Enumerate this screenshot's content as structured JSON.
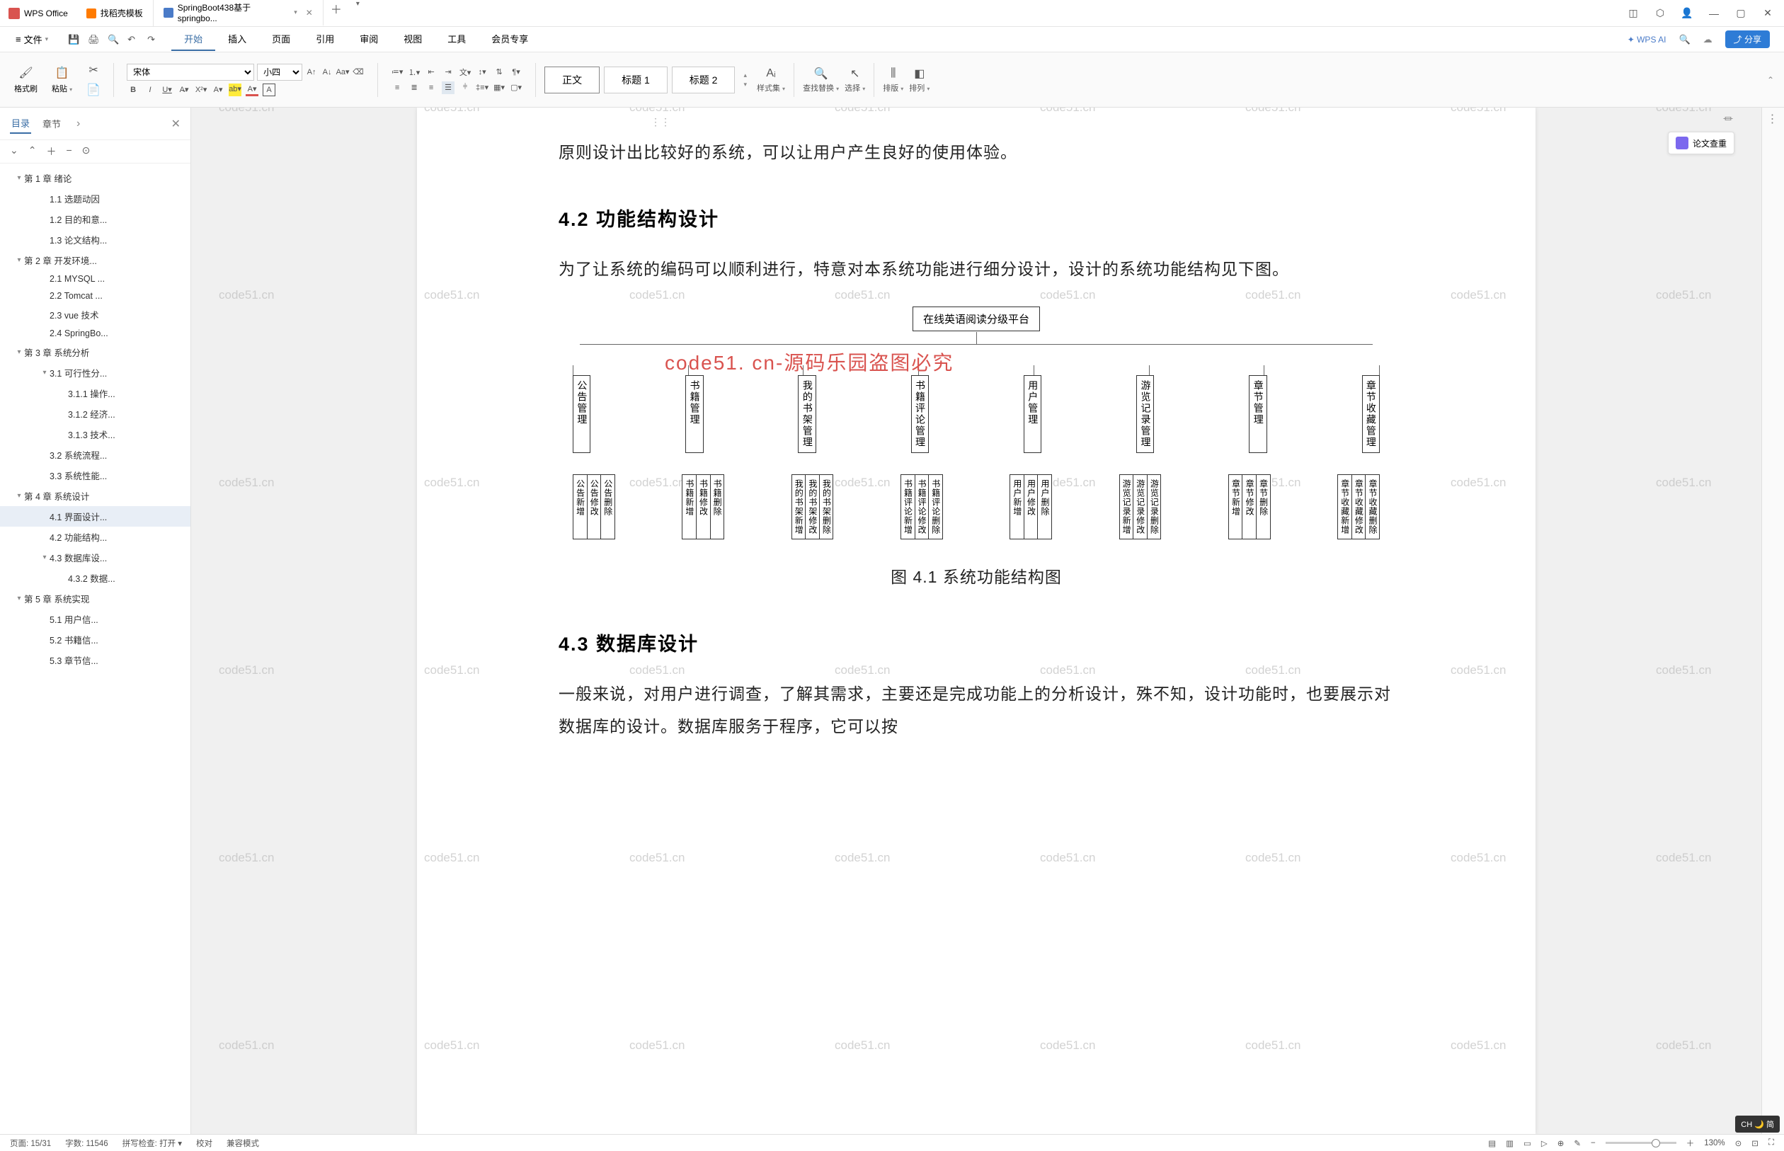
{
  "titlebar": {
    "app_name": "WPS Office",
    "tabs": [
      {
        "label": "找稻壳模板",
        "icon": "orange"
      },
      {
        "label": "SpringBoot438基于springbo...",
        "icon": "blue",
        "active": true
      }
    ]
  },
  "menubar": {
    "file": "文件",
    "menus": [
      "开始",
      "插入",
      "页面",
      "引用",
      "审阅",
      "视图",
      "工具",
      "会员专享"
    ],
    "active_menu": "开始",
    "wps_ai": "WPS AI",
    "share": "分享"
  },
  "ribbon": {
    "format_painter": "格式刷",
    "paste": "粘贴",
    "font_name": "宋体",
    "font_size": "小四",
    "style1": "正文",
    "style2": "标题 1",
    "style3": "标题 2",
    "style_set": "样式集",
    "find_replace": "查找替换",
    "select": "选择",
    "sort": "排版",
    "arrange": "排列"
  },
  "sidebar": {
    "tabs": [
      "目录",
      "章节"
    ],
    "active_tab": "目录",
    "items": [
      {
        "l": 1,
        "t": "第 1 章  绪论",
        "tw": "▾"
      },
      {
        "l": 2,
        "t": "1.1 选题动因"
      },
      {
        "l": 2,
        "t": "1.2 目的和意..."
      },
      {
        "l": 2,
        "t": "1.3 论文结构..."
      },
      {
        "l": 1,
        "t": "第 2 章  开发环境...",
        "tw": "▾"
      },
      {
        "l": 2,
        "t": "2.1 MYSQL ..."
      },
      {
        "l": 2,
        "t": "2.2 Tomcat ..."
      },
      {
        "l": 2,
        "t": "2.3 vue 技术"
      },
      {
        "l": 2,
        "t": "2.4 SpringBo..."
      },
      {
        "l": 1,
        "t": "第 3 章  系统分析",
        "tw": "▾"
      },
      {
        "l": 2,
        "t": "3.1 可行性分...",
        "tw": "▾"
      },
      {
        "l": 3,
        "t": "3.1.1 操作..."
      },
      {
        "l": 3,
        "t": "3.1.2 经济..."
      },
      {
        "l": 3,
        "t": "3.1.3 技术..."
      },
      {
        "l": 2,
        "t": "3.2 系统流程..."
      },
      {
        "l": 2,
        "t": "3.3 系统性能..."
      },
      {
        "l": 1,
        "t": "第 4 章  系统设计",
        "tw": "▾"
      },
      {
        "l": 2,
        "t": "4.1 界面设计...",
        "sel": true
      },
      {
        "l": 2,
        "t": "4.2 功能结构..."
      },
      {
        "l": 2,
        "t": "4.3 数据库设...",
        "tw": "▾"
      },
      {
        "l": 3,
        "t": "4.3.2  数据..."
      },
      {
        "l": 1,
        "t": "第 5 章  系统实现",
        "tw": "▾"
      },
      {
        "l": 2,
        "t": "5.1 用户信..."
      },
      {
        "l": 2,
        "t": "5.2 书籍信..."
      },
      {
        "l": 2,
        "t": "5.3 章节信..."
      }
    ]
  },
  "document": {
    "line1": "原则设计出比较好的系统，可以让用户产生良好的使用体验。",
    "h42": "4.2 功能结构设计",
    "p42": "为了让系统的编码可以顺利进行，特意对本系统功能进行细分设计，设计的系统功能结构见下图。",
    "fig_caption": "图 4.1  系统功能结构图",
    "h43": "4.3 数据库设计",
    "p43": "一般来说，对用户进行调查，了解其需求，主要还是完成功能上的分析设计，殊不知，设计功能时，也要展示对数据库的设计。数据库服务于程序，它可以按",
    "diagram": {
      "root": "在线英语阅读分级平台",
      "nodes": [
        "公告管理",
        "书籍管理",
        "我的书架管理",
        "书籍评论管理",
        "用户管理",
        "游览记录管理",
        "章节管理",
        "章节收藏管理"
      ],
      "leaves": [
        [
          "公告新增",
          "公告修改",
          "公告删除"
        ],
        [
          "书籍新增",
          "书籍修改",
          "书籍删除"
        ],
        [
          "我的书架新增",
          "我的书架修改",
          "我的书架删除"
        ],
        [
          "书籍评论新增",
          "书籍评论修改",
          "书籍评论删除"
        ],
        [
          "用户新增",
          "用户修改",
          "用户删除"
        ],
        [
          "游览记录新增",
          "游览记录修改",
          "游览记录删除"
        ],
        [
          "章节新增",
          "章节修改",
          "章节删除"
        ],
        [
          "章节收藏新增",
          "章节收藏修改",
          "章节收藏删除"
        ]
      ]
    },
    "watermark": "code51.cn",
    "theft_notice": "code51. cn-源码乐园盗图必究"
  },
  "float_btn": "论文查重",
  "ime": "CH 🌙 简",
  "statusbar": {
    "page": "页面: 15/31",
    "words": "字数: 11546",
    "spell": "拼写检查: 打开",
    "proof": "校对",
    "compat": "兼容模式",
    "zoom": "130%"
  }
}
